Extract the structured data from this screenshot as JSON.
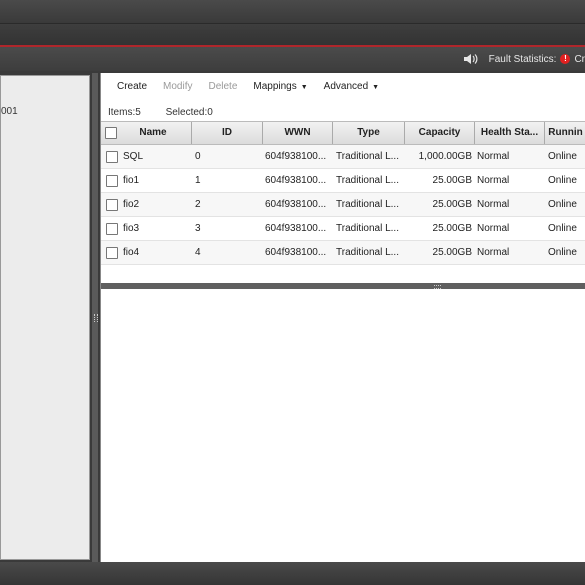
{
  "status": {
    "fault_label": "Fault Statistics:",
    "critical_abbrev": "Cr"
  },
  "left_panel": {
    "item_label": "001"
  },
  "toolbar": {
    "create": "Create",
    "modify": "Modify",
    "delete": "Delete",
    "mappings": "Mappings",
    "advanced": "Advanced"
  },
  "counts": {
    "items": "Items:5",
    "selected": "Selected:0"
  },
  "table": {
    "columns": [
      "Name",
      "ID",
      "WWN",
      "Type",
      "Capacity",
      "Health Sta...",
      "Runnin"
    ],
    "rows": [
      {
        "name": "SQL",
        "id": "0",
        "wwn": "604f938100...",
        "type": "Traditional L...",
        "capacity": "1,000.00GB",
        "health": "Normal",
        "running": "Online"
      },
      {
        "name": "fio1",
        "id": "1",
        "wwn": "604f938100...",
        "type": "Traditional L...",
        "capacity": "25.00GB",
        "health": "Normal",
        "running": "Online"
      },
      {
        "name": "fio2",
        "id": "2",
        "wwn": "604f938100...",
        "type": "Traditional L...",
        "capacity": "25.00GB",
        "health": "Normal",
        "running": "Online"
      },
      {
        "name": "fio3",
        "id": "3",
        "wwn": "604f938100...",
        "type": "Traditional L...",
        "capacity": "25.00GB",
        "health": "Normal",
        "running": "Online"
      },
      {
        "name": "fio4",
        "id": "4",
        "wwn": "604f938100...",
        "type": "Traditional L...",
        "capacity": "25.00GB",
        "health": "Normal",
        "running": "Online"
      }
    ]
  },
  "colors": {
    "accent_red": "#b0262b",
    "critical": "#e02020"
  }
}
